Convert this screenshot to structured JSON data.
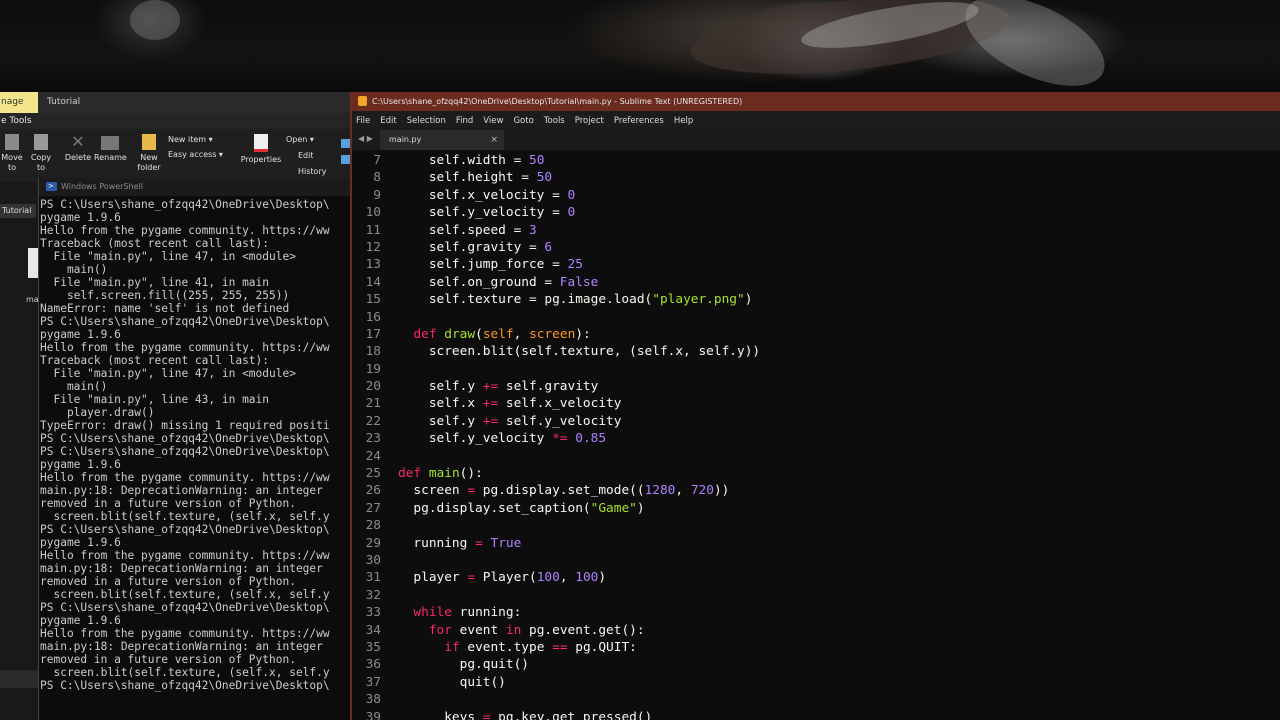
{
  "explorer": {
    "tab_manage": "nage",
    "tab_title": "Tutorial",
    "sub_title": "e Tools",
    "ribbon": {
      "move_to": "Move to",
      "copy_to": "Copy to",
      "delete": "Delete",
      "rename": "Rename",
      "new_folder": "New folder",
      "new_item": "New item ▾",
      "easy_access": "Easy access ▾",
      "properties": "Properties",
      "open": "Open ▾",
      "edit": "Edit",
      "history": "History"
    },
    "nav_label": "Tutorial",
    "file_label": "mai"
  },
  "powershell": {
    "title": "Windows PowerShell",
    "lines": [
      "PS C:\\Users\\shane_ofzqq42\\OneDrive\\Desktop\\",
      "pygame 1.9.6",
      "Hello from the pygame community. https://ww",
      "Traceback (most recent call last):",
      "  File \"main.py\", line 47, in <module>",
      "    main()",
      "  File \"main.py\", line 41, in main",
      "    self.screen.fill((255, 255, 255))",
      "NameError: name 'self' is not defined",
      "PS C:\\Users\\shane_ofzqq42\\OneDrive\\Desktop\\",
      "pygame 1.9.6",
      "Hello from the pygame community. https://ww",
      "Traceback (most recent call last):",
      "  File \"main.py\", line 47, in <module>",
      "    main()",
      "  File \"main.py\", line 43, in main",
      "    player.draw()",
      "TypeError: draw() missing 1 required positi",
      "PS C:\\Users\\shane_ofzqq42\\OneDrive\\Desktop\\",
      "PS C:\\Users\\shane_ofzqq42\\OneDrive\\Desktop\\",
      "pygame 1.9.6",
      "Hello from the pygame community. https://ww",
      "main.py:18: DeprecationWarning: an integer",
      "removed in a future version of Python.",
      "  screen.blit(self.texture, (self.x, self.y",
      "PS C:\\Users\\shane_ofzqq42\\OneDrive\\Desktop\\",
      "pygame 1.9.6",
      "Hello from the pygame community. https://ww",
      "main.py:18: DeprecationWarning: an integer",
      "removed in a future version of Python.",
      "  screen.blit(self.texture, (self.x, self.y",
      "PS C:\\Users\\shane_ofzqq42\\OneDrive\\Desktop\\",
      "pygame 1.9.6",
      "Hello from the pygame community. https://ww",
      "main.py:18: DeprecationWarning: an integer",
      "removed in a future version of Python.",
      "  screen.blit(self.texture, (self.x, self.y",
      "PS C:\\Users\\shane_ofzqq42\\OneDrive\\Desktop\\"
    ]
  },
  "sublime": {
    "title": "C:\\Users\\shane_ofzqq42\\OneDrive\\Desktop\\Tutorial\\main.py - Sublime Text (UNREGISTERED)",
    "menu": [
      "File",
      "Edit",
      "Selection",
      "Find",
      "View",
      "Goto",
      "Tools",
      "Project",
      "Preferences",
      "Help"
    ],
    "tab_label": "main.py",
    "tab_close": "×",
    "nav_arrows": "◀ ▶"
  },
  "editor": {
    "lines": [
      {
        "n": "7",
        "tokens": [
          [
            "    self.width = ",
            ""
          ],
          [
            "50",
            "n"
          ]
        ]
      },
      {
        "n": "8",
        "tokens": [
          [
            "    self.height = ",
            ""
          ],
          [
            "50",
            "n"
          ]
        ]
      },
      {
        "n": "9",
        "tokens": [
          [
            "    self.x_velocity = ",
            ""
          ],
          [
            "0",
            "n"
          ]
        ]
      },
      {
        "n": "10",
        "tokens": [
          [
            "    self.y_velocity = ",
            ""
          ],
          [
            "0",
            "n"
          ]
        ]
      },
      {
        "n": "11",
        "tokens": [
          [
            "    self.speed = ",
            ""
          ],
          [
            "3",
            "n"
          ]
        ]
      },
      {
        "n": "12",
        "tokens": [
          [
            "    self.gravity = ",
            ""
          ],
          [
            "6",
            "n"
          ]
        ]
      },
      {
        "n": "13",
        "tokens": [
          [
            "    self.jump_force = ",
            ""
          ],
          [
            "25",
            "n"
          ]
        ]
      },
      {
        "n": "14",
        "tokens": [
          [
            "    self.on_ground = ",
            ""
          ],
          [
            "False",
            "n"
          ]
        ]
      },
      {
        "n": "15",
        "tokens": [
          [
            "    self.texture = pg.image.load(",
            ""
          ],
          [
            "\"player.png\"",
            "s"
          ],
          [
            ")",
            ""
          ]
        ]
      },
      {
        "n": "16",
        "tokens": []
      },
      {
        "n": "17",
        "tokens": [
          [
            "  ",
            ""
          ],
          [
            "def",
            "kd"
          ],
          [
            " ",
            ""
          ],
          [
            "draw",
            "fn"
          ],
          [
            "(",
            ""
          ],
          [
            "self",
            "f"
          ],
          [
            ", ",
            ""
          ],
          [
            "screen",
            "f"
          ],
          [
            "):",
            ""
          ]
        ]
      },
      {
        "n": "18",
        "tokens": [
          [
            "    screen.blit(self.texture, (self.x, self.y))",
            ""
          ]
        ]
      },
      {
        "n": "19",
        "tokens": []
      },
      {
        "n": "20",
        "tokens": [
          [
            "    self.y ",
            ""
          ],
          [
            "+=",
            "k"
          ],
          [
            " self.gravity",
            ""
          ]
        ]
      },
      {
        "n": "21",
        "tokens": [
          [
            "    self.x ",
            ""
          ],
          [
            "+=",
            "k"
          ],
          [
            " self.x_velocity",
            ""
          ]
        ]
      },
      {
        "n": "22",
        "tokens": [
          [
            "    self.y ",
            ""
          ],
          [
            "+=",
            "k"
          ],
          [
            " self.y_velocity",
            ""
          ]
        ]
      },
      {
        "n": "23",
        "tokens": [
          [
            "    self.y_velocity ",
            ""
          ],
          [
            "*=",
            "k"
          ],
          [
            " ",
            ""
          ],
          [
            "0.85",
            "n"
          ]
        ]
      },
      {
        "n": "24",
        "tokens": []
      },
      {
        "n": "25",
        "tokens": [
          [
            "def",
            "kd"
          ],
          [
            " ",
            ""
          ],
          [
            "main",
            "fn"
          ],
          [
            "():",
            ""
          ]
        ]
      },
      {
        "n": "26",
        "tokens": [
          [
            "  screen ",
            ""
          ],
          [
            "=",
            "k"
          ],
          [
            " pg.display.set_mode((",
            ""
          ],
          [
            "1280",
            "n"
          ],
          [
            ", ",
            ""
          ],
          [
            "720",
            "n"
          ],
          [
            "))",
            ""
          ]
        ]
      },
      {
        "n": "27",
        "tokens": [
          [
            "  pg.display.set_caption(",
            ""
          ],
          [
            "\"Game\"",
            "s"
          ],
          [
            ")",
            ""
          ]
        ]
      },
      {
        "n": "28",
        "tokens": []
      },
      {
        "n": "29",
        "tokens": [
          [
            "  running ",
            ""
          ],
          [
            "=",
            "k"
          ],
          [
            " ",
            ""
          ],
          [
            "True",
            "n"
          ]
        ]
      },
      {
        "n": "30",
        "tokens": []
      },
      {
        "n": "31",
        "tokens": [
          [
            "  player ",
            ""
          ],
          [
            "=",
            "k"
          ],
          [
            " Player(",
            ""
          ],
          [
            "100",
            "n"
          ],
          [
            ", ",
            ""
          ],
          [
            "100",
            "n"
          ],
          [
            ")",
            ""
          ]
        ]
      },
      {
        "n": "32",
        "tokens": []
      },
      {
        "n": "33",
        "tokens": [
          [
            "  ",
            ""
          ],
          [
            "while",
            "k"
          ],
          [
            " running:",
            ""
          ]
        ]
      },
      {
        "n": "34",
        "tokens": [
          [
            "    ",
            ""
          ],
          [
            "for",
            "k"
          ],
          [
            " event ",
            ""
          ],
          [
            "in",
            "k"
          ],
          [
            " pg.event.get():",
            ""
          ]
        ]
      },
      {
        "n": "35",
        "tokens": [
          [
            "      ",
            ""
          ],
          [
            "if",
            "k"
          ],
          [
            " event.type ",
            ""
          ],
          [
            "==",
            "k"
          ],
          [
            " pg.QUIT:",
            ""
          ]
        ]
      },
      {
        "n": "36",
        "tokens": [
          [
            "        pg.quit()",
            ""
          ]
        ]
      },
      {
        "n": "37",
        "tokens": [
          [
            "        quit()",
            ""
          ]
        ]
      },
      {
        "n": "38",
        "tokens": []
      },
      {
        "n": "39",
        "tokens": [
          [
            "      keys ",
            ""
          ],
          [
            "=",
            "k"
          ],
          [
            " pg.key.get_pressed()",
            ""
          ]
        ]
      }
    ]
  },
  "colors": {
    "sublime_titlebar": "#6b2c1f",
    "keyword": "#f92672",
    "string": "#a6e22e",
    "number": "#ae81ff",
    "param": "#fd971f"
  }
}
